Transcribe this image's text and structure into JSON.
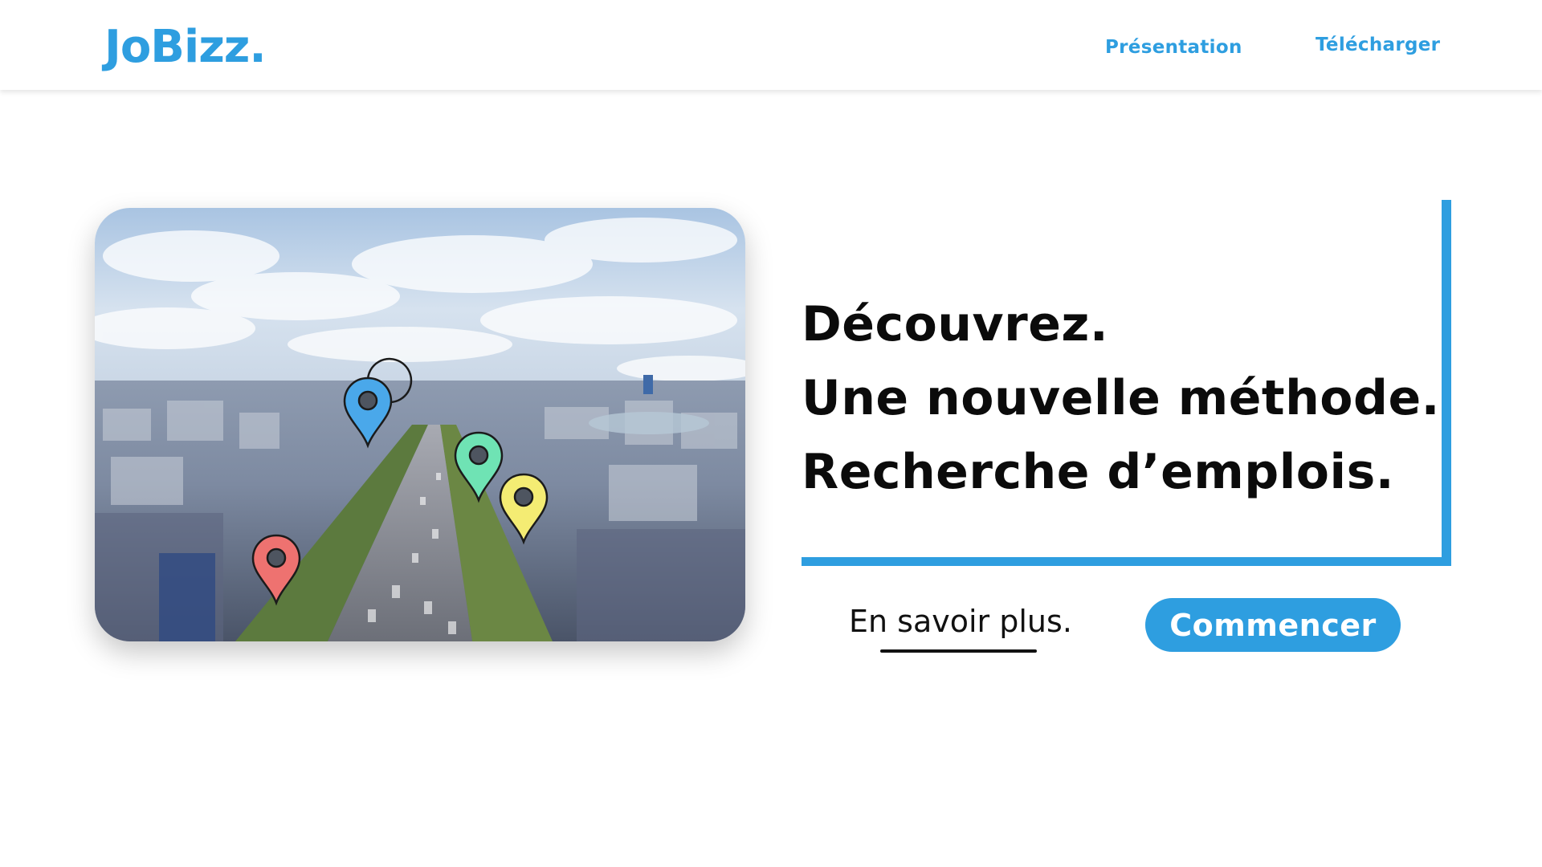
{
  "header": {
    "logo": "JoBizz.",
    "nav": [
      {
        "label": "Présentation"
      },
      {
        "label": "Télécharger"
      }
    ]
  },
  "hero": {
    "image_alt": "Aerial city avenue with map pins",
    "pins": [
      {
        "color": "#4aa8ea",
        "name": "blue-pin"
      },
      {
        "color": "#6fe3b4",
        "name": "green-pin"
      },
      {
        "color": "#f4ec73",
        "name": "yellow-pin"
      },
      {
        "color": "#ee7270",
        "name": "red-pin"
      }
    ]
  },
  "headline": {
    "lines": [
      "Découvrez.",
      "Une nouvelle méthode.",
      "Recherche d’emplois."
    ]
  },
  "actions": {
    "learn_more": "En savoir plus.",
    "start": "Commencer"
  },
  "colors": {
    "accent": "#2e9ee0",
    "text": "#0b0b0b",
    "background": "#ffffff"
  }
}
